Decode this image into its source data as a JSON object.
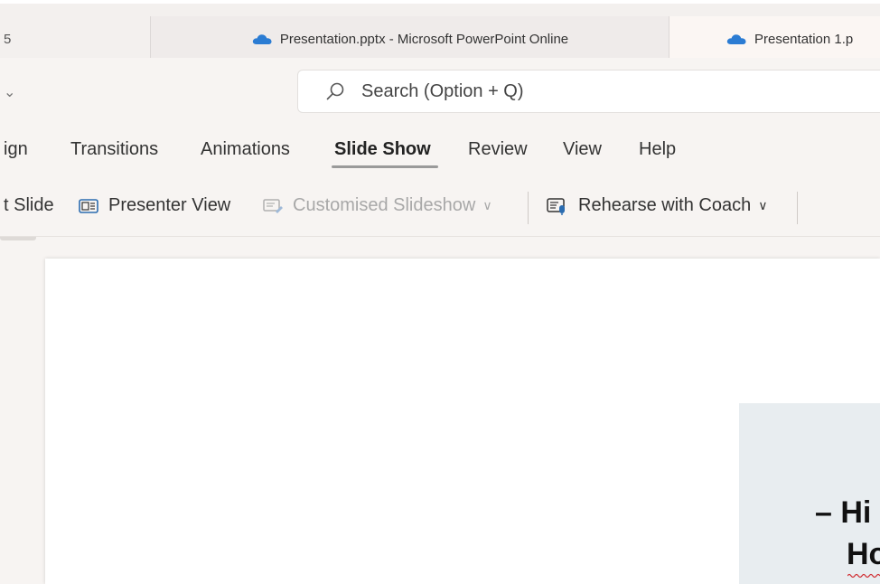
{
  "browser": {
    "tabs": [
      {
        "label": "5",
        "active": false
      },
      {
        "label": "Presentation.pptx - Microsoft PowerPoint Online",
        "active": true
      },
      {
        "label": "Presentation 1.p",
        "active": false
      }
    ]
  },
  "header": {
    "search_placeholder": "Search (Option + Q)"
  },
  "ribbon": {
    "tabs": [
      "ign",
      "Transitions",
      "Animations",
      "Slide Show",
      "Review",
      "View",
      "Help"
    ],
    "active_tab": "Slide Show"
  },
  "toolbar": {
    "from_current_label": "t Slide",
    "presenter_view_label": "Presenter View",
    "custom_slideshow_label": "Customised Slideshow",
    "rehearse_label": "Rehearse with Coach"
  },
  "slide": {
    "line1": "– Hi",
    "line2": "Ho"
  },
  "colors": {
    "accent_cloud": "#2b7cd3",
    "ribbon_bg": "#f7f4f2",
    "textbox_bg": "#e8edf0"
  }
}
